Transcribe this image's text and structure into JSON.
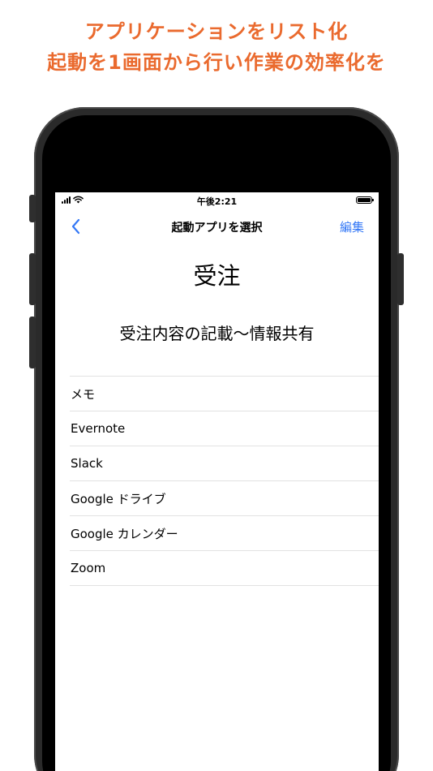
{
  "promo": {
    "line1": "アプリケーションをリスト化",
    "line2": "起動を1画面から行い作業の効率化を",
    "color": "#ea6a2e"
  },
  "status_bar": {
    "time": "午後2:21",
    "icons": [
      "signal-icon",
      "wifi-icon",
      "battery-icon"
    ]
  },
  "nav": {
    "back_icon": "chevron-left-icon",
    "title": "起動アプリを選択",
    "edit_label": "編集",
    "accent_color": "#3478f6"
  },
  "category": {
    "title": "受注",
    "description": "受注内容の記載〜情報共有"
  },
  "apps": [
    {
      "label": "メモ"
    },
    {
      "label": "Evernote"
    },
    {
      "label": "Slack"
    },
    {
      "label": "Google ドライブ"
    },
    {
      "label": "Google カレンダー"
    },
    {
      "label": "Zoom"
    }
  ]
}
